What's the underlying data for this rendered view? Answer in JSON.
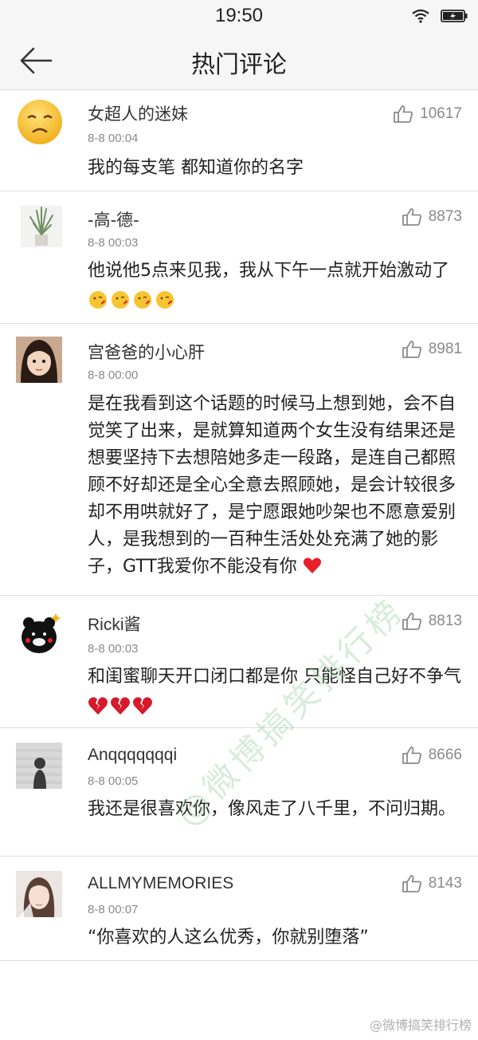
{
  "status": {
    "time": "19:50"
  },
  "nav": {
    "title": "热门评论"
  },
  "comments": [
    {
      "name": "女超人的迷妹",
      "time": "8-8 00:04",
      "likes": "10617",
      "text": "我的每支笔 都知道你的名字",
      "avatar": "sad-face"
    },
    {
      "name": "-高-德-",
      "time": "8-8 00:03",
      "likes": "8873",
      "text": "他说他5点来见我，我从下午一点就开始激动了",
      "avatar": "plant"
    },
    {
      "name": "宫爸爸的小心肝",
      "time": "8-8 00:00",
      "likes": "8981",
      "text": "是在我看到这个话题的时候马上想到她，会不自觉笑了出来，是就算知道两个女生没有结果还是想要坚持下去想陪她多走一段路，是连自己都照顾不好却还是全心全意去照顾她，是会计较很多却不用哄就好了，是宁愿跟她吵架也不愿意爱别人，是我想到的一百种生活处处充满了她的影子，GTT我爱你不能没有你",
      "avatar": "child"
    },
    {
      "name": "Ricki酱",
      "time": "8-8 00:03",
      "likes": "8813",
      "text": "和闺蜜聊天开口闭口都是你 只能怪自己好不争气",
      "avatar": "bear"
    },
    {
      "name": "Anqqqqqqqi",
      "time": "8-8 00:05",
      "likes": "8666",
      "text": "我还是很喜欢你，像风走了八千里，不问归期。",
      "avatar": "silhouette"
    },
    {
      "name": "ALLMYMEMORIES",
      "time": "8-8 00:07",
      "likes": "8143",
      "text": "“你喜欢的人这么优秀，你就别堕落”",
      "avatar": "portrait"
    }
  ],
  "watermark": "@微博搞笑排行榜",
  "footer_watermark": "@微博搞笑排行榜",
  "colors": {
    "accent_heart": "#e8202a",
    "meta_gray": "#8a8a8a"
  }
}
